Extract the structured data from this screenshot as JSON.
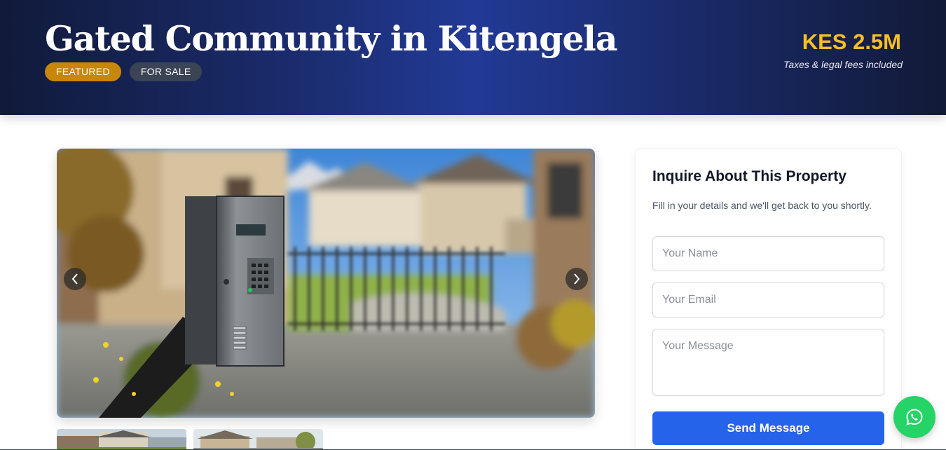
{
  "property": {
    "title": "Gated Community in Kitengela",
    "badges": {
      "featured": "FEATURED",
      "status": "FOR SALE"
    },
    "price": "KES 2.5M",
    "price_note": "Taxes & legal fees included"
  },
  "gallery": {
    "main_image": "gated-entrance-keypad-photo",
    "prev_icon": "chevron-left-icon",
    "next_icon": "chevron-right-icon",
    "thumbnails": [
      "house-thumbnail",
      "estate-thumbnail"
    ]
  },
  "inquiry": {
    "title": "Inquire About This Property",
    "subtitle": "Fill in your details and we'll get back to you shortly.",
    "name_placeholder": "Your Name",
    "email_placeholder": "Your Email",
    "message_placeholder": "Your Message",
    "submit_label": "Send Message"
  },
  "floating": {
    "whatsapp_icon": "whatsapp-icon"
  },
  "colors": {
    "accent_blue": "#2563eb",
    "price_gold": "#fbbf24",
    "featured_badge": "#c8860a",
    "status_badge": "#3b4454",
    "whatsapp_green": "#25d366",
    "hero_dark": "#111a3a"
  }
}
